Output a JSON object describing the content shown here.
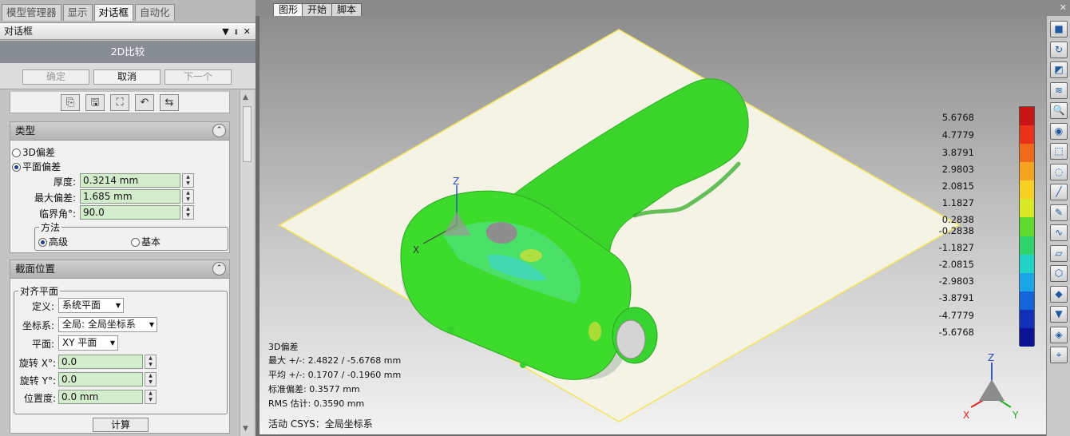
{
  "left_tabs": [
    "模型管理器",
    "显示",
    "对话框",
    "自动化"
  ],
  "left_tabs_active": 2,
  "dock": {
    "title": "对话框",
    "ctrl_menu": "▼",
    "ctrl_pin": "ᵻ",
    "ctrl_close": "✕"
  },
  "dialog": {
    "title": "2D比较",
    "buttons": {
      "ok": "确定",
      "cancel": "取消",
      "next": "下一个"
    }
  },
  "icon_row": [
    "⎘",
    "🖫",
    "⛶",
    "↶",
    "⇆"
  ],
  "type_section": {
    "title": "类型",
    "options": [
      "3D偏差",
      "平面偏差"
    ],
    "selected": 1,
    "thickness_label": "厚度:",
    "thickness_value": "0.3214 mm",
    "max_dev_label": "最大偏差:",
    "max_dev_value": "1.685 mm",
    "critical_angle_label": "临界角°:",
    "critical_angle_value": "90.0",
    "method_group": "方法",
    "method_options": [
      "高级",
      "基本"
    ],
    "method_selected": 0
  },
  "section_position": {
    "title": "截面位置",
    "align_group": "对齐平面",
    "define_label": "定义:",
    "define_value": "系统平面",
    "csys_label": "坐标系:",
    "csys_value": "全局: 全局坐标系",
    "plane_label": "平面:",
    "plane_value": "XY 平面",
    "rot_x_label": "旋转 X°:",
    "rot_x_value": "0.0",
    "rot_y_label": "旋转 Y°:",
    "rot_y_value": "0.0",
    "pos_label": "位置度:",
    "pos_value": "0.0 mm",
    "calc_button": "计算"
  },
  "view_tabs": [
    "图形",
    "开始",
    "脚本"
  ],
  "view_tabs_active": 0,
  "view_corner": "✕",
  "stats": {
    "title": "3D偏差",
    "max": "最大 +/-: 2.4822 / -5.6768 mm",
    "avg": "平均 +/-: 0.1707 / -0.1960 mm",
    "std": "标准偏差: 0.3577 mm",
    "rms": "RMS 估计:  0.3590 mm"
  },
  "active_csys": "活动 CSYS：全局坐标系",
  "legend": [
    "5.6768",
    "4.7779",
    "3.8791",
    "2.9803",
    "2.0815",
    "1.1827",
    "0.2838",
    "-0.2838",
    "-1.1827",
    "-2.0815",
    "-2.9803",
    "-3.8791",
    "-4.7779",
    "-5.6768"
  ],
  "colors": {
    "model_green": "#33dd22",
    "plane_fill": "#f4f3e6",
    "plane_edge": "#f2e65a",
    "colorbar": [
      "#c81414",
      "#e8321a",
      "#f06a1c",
      "#f5a321",
      "#f8d023",
      "#d7e827",
      "#5fd92b",
      "#2ed36b",
      "#20d3c6",
      "#1aa6e6",
      "#1466d8",
      "#1230b8",
      "#0c1394"
    ]
  },
  "model_axis": {
    "z": "Z",
    "x": "X"
  },
  "corner_axis": {
    "z": "Z",
    "x": "X",
    "y": "Y"
  },
  "right_toolbar_icons": [
    "cube-view-icon",
    "rotate-icon",
    "plane-view-icon",
    "layer-icon",
    "zoom-icon",
    "color-map-icon",
    "select-rect-icon",
    "select-lasso-icon",
    "select-line-icon",
    "brush-icon",
    "curve-icon",
    "select-poly-icon",
    "select-3d-icon",
    "paint-icon",
    "filter-icon",
    "palette-icon",
    "tag-icon"
  ]
}
